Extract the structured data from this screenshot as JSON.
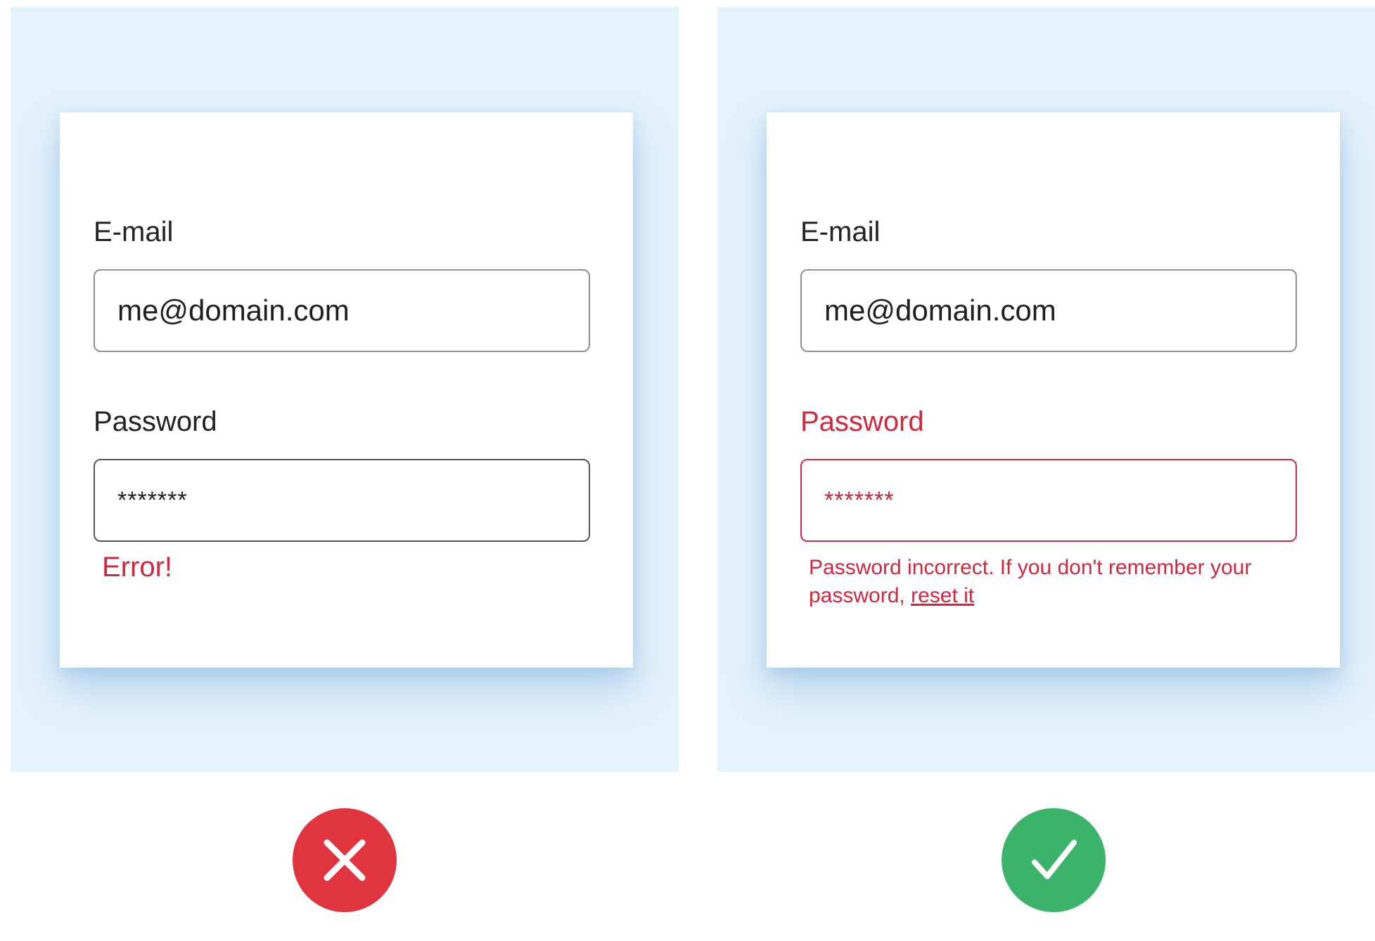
{
  "left_example": {
    "email_label": "E-mail",
    "email_value": "me@domain.com",
    "password_label": "Password",
    "password_value": "*******",
    "error_text": "Error!"
  },
  "right_example": {
    "email_label": "E-mail",
    "email_value": "me@domain.com",
    "password_label": "Password",
    "password_value": "*******",
    "error_text": "Password incorrect. If you don't remember your password,",
    "reset_link": "reset it"
  },
  "badges": {
    "bad_icon": "close-icon",
    "good_icon": "check-icon"
  },
  "colors": {
    "panel_bg": "#e4f2fc",
    "error": "#d0283c",
    "bad_badge": "#e0353f",
    "good_badge": "#3bb36a"
  }
}
